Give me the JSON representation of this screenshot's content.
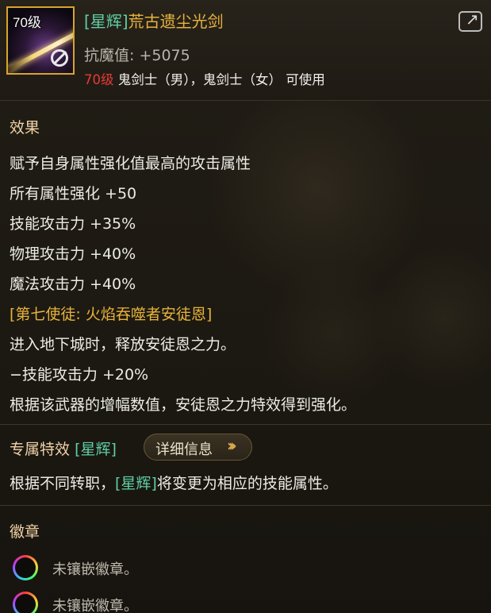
{
  "item": {
    "level_badge": "70级",
    "title_tag": "[星辉]",
    "title_name": "荒古遗尘光剑",
    "stat": "抗魔值: +5075",
    "req_level": "70级",
    "req_classes": " 鬼剑士（男），鬼剑士（女） 可使用",
    "colors": {
      "gold": "#e7b23c",
      "tag": "#5fcfa6",
      "req_red": "#e53a35"
    }
  },
  "icons": {
    "share": "share-arrow-icon",
    "item": "sword-icon",
    "lock": "lock-icon",
    "socket": "socket-icon"
  },
  "effects": {
    "heading": "效果",
    "lines": [
      "赋予自身属性强化值最高的攻击属性",
      "所有属性强化 +50",
      "技能攻击力 +35%",
      "物理攻击力 +40%",
      "魔法攻击力 +40%"
    ],
    "apostle_title": "[第七使徒: 火焰吞噬者安徒恩]",
    "apostle_lines": [
      "进入地下城时，释放安徒恩之力。",
      "−技能攻击力 +20%",
      "根据该武器的增幅数值，安徒恩之力特效得到强化。"
    ]
  },
  "exclusive": {
    "label": "专属特效",
    "tag": "[星辉]",
    "button": "详细信息",
    "desc_before": "根据不同转职，",
    "desc_tag": "[星辉]",
    "desc_after": "将变更为相应的技能属性。"
  },
  "emblem": {
    "heading": "徽章",
    "slots": [
      "未镶嵌徽章。",
      "未镶嵌徽章。"
    ]
  }
}
